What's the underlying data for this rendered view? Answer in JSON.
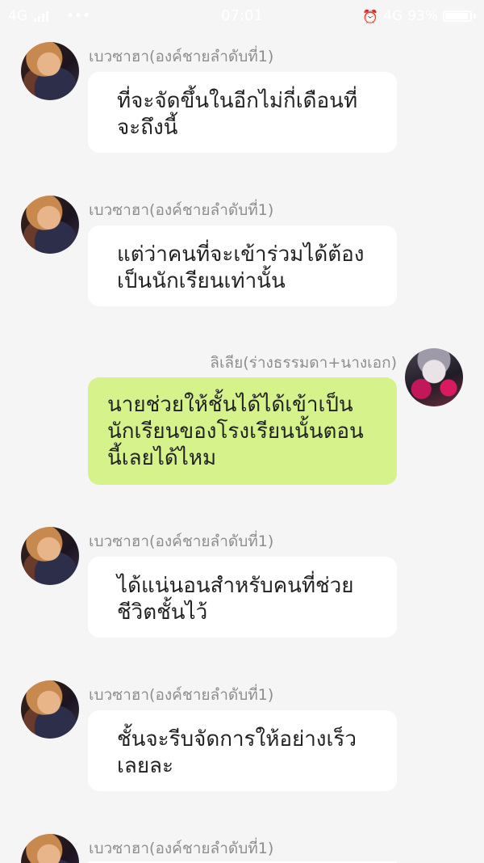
{
  "status_bar": {
    "network_left": "4G",
    "dots": "•••",
    "time": "07:01",
    "network_right": "4G",
    "battery": "93%",
    "battery_level": 0.93
  },
  "messages": [
    {
      "sender": "เบวซาฮา(องค์ชายลำดับที่1)",
      "side": "in",
      "text": "ที่จะจัดขึ้นในอีกไม่กี่เดือนที่\nจะถึงนี้"
    },
    {
      "sender": "เบวซาฮา(องค์ชายลำดับที่1)",
      "side": "in",
      "text": "แต่ว่าคนที่จะเข้าร่วมได้ต้อง\nเป็นนักเรียนเท่านั้น"
    },
    {
      "sender": "ลิเลีย(ร่างธรรมดา+นางเอก)",
      "side": "out",
      "text": "นายช่วยให้ชั้นได้ได้เข้าเป็น\nนักเรียนของโรงเรียนนั้นตอน\nนี้เลยได้ไหม"
    },
    {
      "sender": "เบวซาฮา(องค์ชายลำดับที่1)",
      "side": "in",
      "text": "ได้แน่นอนสำหรับคนที่ช่วย\nชีวิตชั้นไว้"
    },
    {
      "sender": "เบวซาฮา(องค์ชายลำดับที่1)",
      "side": "in",
      "text": "ชั้นจะรีบจัดการให้อย่างเร็ว\nเลยละ"
    },
    {
      "sender": "เบวซาฮา(องค์ชายลำดับที่1)",
      "side": "in",
      "text": ""
    }
  ]
}
